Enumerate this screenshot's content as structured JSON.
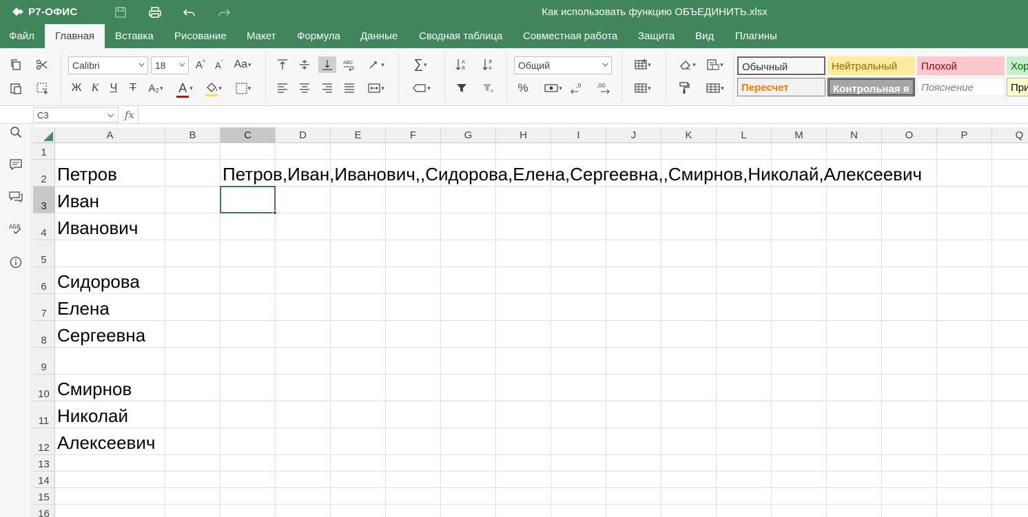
{
  "app": {
    "logo": "Р7-ОФИС",
    "title": "Как использовать функцию ОБЪЕДИНИТЬ.xlsx"
  },
  "menu": [
    "Файл",
    "Главная",
    "Вставка",
    "Рисование",
    "Макет",
    "Формула",
    "Данные",
    "Сводная таблица",
    "Совместная работа",
    "Защита",
    "Вид",
    "Плагины"
  ],
  "active_menu": "Главная",
  "toolbar": {
    "font_name": "Calibri",
    "font_size": "18",
    "number_format": "Общий",
    "bold": "Ж",
    "italic": "К",
    "underline": "Ч",
    "strike": "Т",
    "subscript": "A₂",
    "font_color_letter": "A",
    "case_label": "Aa",
    "percent": "%",
    "sum": "∑"
  },
  "styles": {
    "row1": [
      {
        "label": "Обычный",
        "bg": "#ffffff",
        "color": "#000000",
        "border": "#666666"
      },
      {
        "label": "Нейтральный",
        "bg": "#ffeb9c",
        "color": "#9c6500",
        "border": "#ffeb9c"
      },
      {
        "label": "Плохой",
        "bg": "#ffc7ce",
        "color": "#9c0006",
        "border": "#ffc7ce"
      },
      {
        "label": "Хор",
        "bg": "#c6efce",
        "color": "#006100",
        "border": "#c6efce"
      }
    ],
    "row2": [
      {
        "label": "Пересчет",
        "bg": "#f2f2f2",
        "color": "#fa7d00",
        "border": "#7f7f7f"
      },
      {
        "label": "Контрольная я",
        "bg": "#a5a5a5",
        "color": "#ffffff",
        "border": "#3f3f3f"
      },
      {
        "label": "Пояснение",
        "bg": "#ffffff",
        "color": "#7f7f7f",
        "border": "#ffffff"
      },
      {
        "label": "При",
        "bg": "#ffffcc",
        "color": "#000000",
        "border": "#b2b2b2"
      }
    ]
  },
  "formula_bar": {
    "name_box": "C3",
    "fx": "fx",
    "formula": ""
  },
  "columns": [
    "A",
    "B",
    "C",
    "D",
    "E",
    "F",
    "G",
    "H",
    "I",
    "J",
    "K",
    "L",
    "M",
    "N",
    "O",
    "P",
    "Q"
  ],
  "selected_column": "C",
  "selected_row": "3",
  "rows": [
    "1",
    "2",
    "3",
    "4",
    "5",
    "6",
    "7",
    "8",
    "9",
    "10",
    "11",
    "12",
    "13",
    "14",
    "15",
    "16"
  ],
  "cells": {
    "A2": "Петров",
    "A3": "Иван",
    "A4": "Иванович",
    "A6": "Сидорова",
    "A7": "Елена",
    "A8": "Сергеевна",
    "A10": "Смирнов",
    "A11": "Николай",
    "A12": "Алексеевич",
    "C2": "Петров,Иван,Иванович,,Сидорова,Елена,Сергеевна,,Смирнов,Николай,Алексеевич"
  },
  "colors": {
    "brand": "#40865c",
    "selection": "#3e7a50",
    "font_red": "#e00000",
    "highlight_yellow": "#ffea00"
  }
}
